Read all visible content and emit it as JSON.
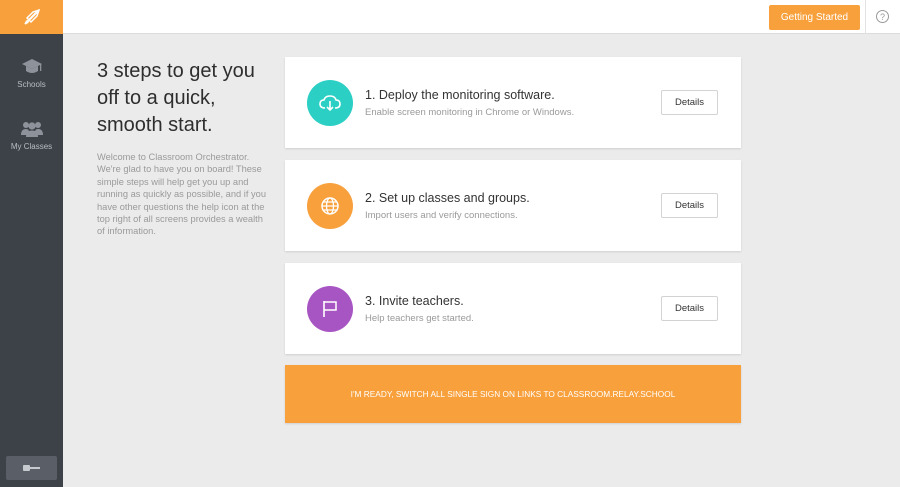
{
  "sidebar": {
    "logo_icon": "compass-logo-icon",
    "items": [
      {
        "label": "Schools",
        "icon": "graduation-cap-icon"
      },
      {
        "label": "My Classes",
        "icon": "users-icon"
      }
    ],
    "bottom_icon": "key-icon"
  },
  "header": {
    "getting_started_label": "Getting Started",
    "help_icon_glyph": "?"
  },
  "intro": {
    "title": "3 steps to get you off to a quick, smooth start.",
    "body": "Welcome to Classroom Orchestrator. We're glad to have you on board! These simple steps will help get you up and running as quickly as possible, and if you have other questions the help icon at the top right of all screens provides a wealth of information."
  },
  "steps": [
    {
      "title": "1. Deploy the monitoring software.",
      "subtitle": "Enable screen monitoring in Chrome or Windows.",
      "button": "Details",
      "icon": "cloud-download-icon",
      "color": "#2bcfc4"
    },
    {
      "title": "2. Set up classes and groups.",
      "subtitle": "Import users and verify connections.",
      "button": "Details",
      "icon": "globe-icon",
      "color": "#f7a03c"
    },
    {
      "title": "3. Invite teachers.",
      "subtitle": "Help teachers get started.",
      "button": "Details",
      "icon": "flag-icon",
      "color": "#a855c4"
    }
  ],
  "ready_banner": "I'M READY, SWITCH ALL SINGLE SIGN ON LINKS TO CLASSROOM.RELAY.SCHOOL",
  "colors": {
    "accent": "#f7a03c",
    "sidebar": "#3d4148",
    "background": "#ebebeb"
  }
}
